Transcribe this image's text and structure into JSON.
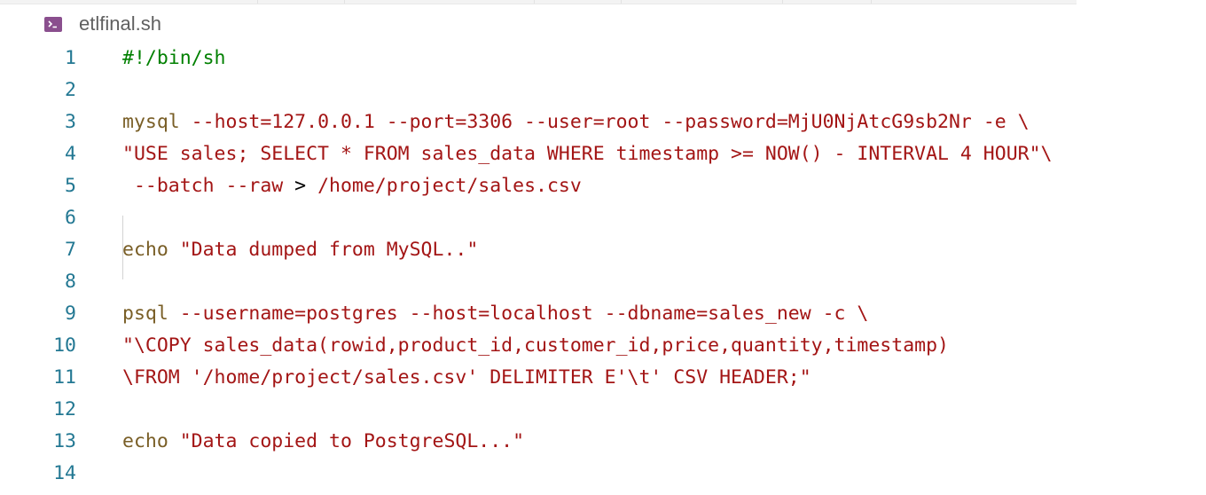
{
  "tab": {
    "icon": "terminal-icon",
    "title": "etlfinal.sh"
  },
  "editor": {
    "lines": [
      {
        "n": "1",
        "parts": [
          {
            "t": "#!/bin/sh",
            "c": "comment"
          }
        ]
      },
      {
        "n": "2",
        "parts": []
      },
      {
        "n": "3",
        "parts": [
          {
            "t": "mysql",
            "c": "cmd"
          },
          {
            "t": " --host=127.0.0.1 --port=3306 --user=root --password=MjU0NjAtcG9sb2Nr -e \\",
            "c": "str"
          }
        ]
      },
      {
        "n": "4",
        "parts": [
          {
            "t": "\"USE sales; SELECT * FROM sales_data WHERE timestamp >= NOW() - INTERVAL 4 HOUR\"\\",
            "c": "str"
          }
        ]
      },
      {
        "n": "5",
        "parts": [
          {
            "t": " --batch --raw ",
            "c": "str"
          },
          {
            "t": ">",
            "c": "plain"
          },
          {
            "t": " /home/project/sales.csv",
            "c": "str"
          }
        ]
      },
      {
        "n": "6",
        "parts": []
      },
      {
        "n": "7",
        "parts": [
          {
            "t": "echo",
            "c": "cmd"
          },
          {
            "t": " \"Data dumped from MySQL..\"",
            "c": "str"
          }
        ]
      },
      {
        "n": "8",
        "parts": []
      },
      {
        "n": "9",
        "parts": [
          {
            "t": "psql",
            "c": "cmd"
          },
          {
            "t": " --username=postgres --host=localhost --dbname=sales_new -c \\",
            "c": "str"
          }
        ]
      },
      {
        "n": "10",
        "parts": [
          {
            "t": "\"\\COPY sales_data(rowid,product_id,customer_id,price,quantity,timestamp)",
            "c": "str"
          }
        ]
      },
      {
        "n": "11",
        "parts": [
          {
            "t": "\\FROM '/home/project/sales.csv' DELIMITER E'\\t' CSV HEADER;\"",
            "c": "str"
          }
        ]
      },
      {
        "n": "12",
        "parts": []
      },
      {
        "n": "13",
        "parts": [
          {
            "t": "echo",
            "c": "cmd"
          },
          {
            "t": " \"Data copied to PostgreSQL...\"",
            "c": "str"
          }
        ]
      },
      {
        "n": "14",
        "parts": []
      }
    ]
  },
  "colors": {
    "line_number": "#237893",
    "string": "#a31515",
    "command": "#795e26",
    "comment": "#008000",
    "tab_icon": "#8a4f8e"
  }
}
